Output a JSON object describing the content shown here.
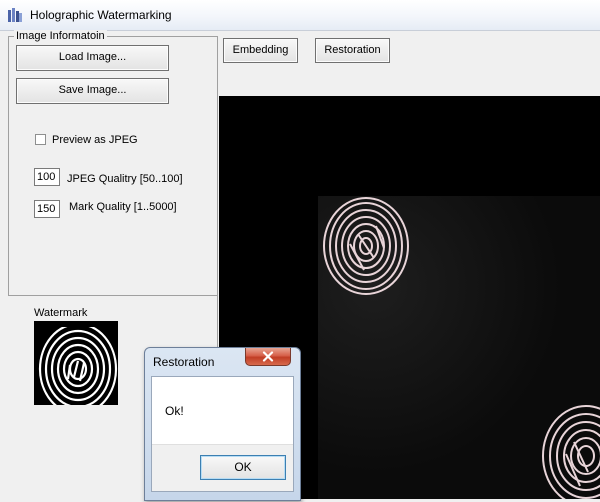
{
  "window": {
    "title": "Holographic Watermarking",
    "icon": "app-icon"
  },
  "left_panel": {
    "group_title": "Image Informatoin",
    "load_button": "Load Image...",
    "save_button": "Save Image...",
    "preview_checkbox": {
      "label": "Preview as JPEG",
      "checked": false
    },
    "jpeg_quality": {
      "value": "100",
      "label": "JPEG Qualitry [50..100]"
    },
    "mark_quality": {
      "value": "150",
      "label": "Mark Quality [1..5000]"
    },
    "watermark_label": "Watermark"
  },
  "toolbar": {
    "embedding": "Embedding",
    "restoration": "Restoration"
  },
  "dialog": {
    "title": "Restoration",
    "message": "Ok!",
    "ok_button": "OK"
  },
  "colors": {
    "canvas": "#000000",
    "fingerprint": "#e8d4d8",
    "close": "#c94a34"
  }
}
